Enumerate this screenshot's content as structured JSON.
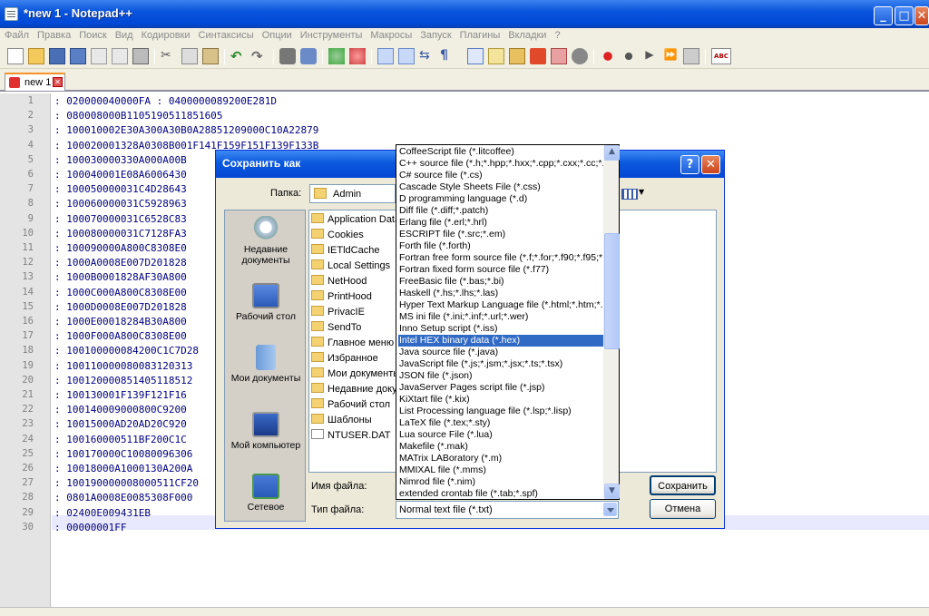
{
  "window": {
    "title": "*new 1 - Notepad++"
  },
  "menu": [
    "Файл",
    "Правка",
    "Поиск",
    "Вид",
    "Кодировки",
    "Синтаксисы",
    "Опции",
    "Инструменты",
    "Макросы",
    "Запуск",
    "Плагины",
    "Вкладки",
    "?"
  ],
  "tab": {
    "label": "new 1"
  },
  "editor": {
    "lines": [
      {
        "n": "1",
        "text": ": 020000040000FA : 0400000089200E281D"
      },
      {
        "n": "2",
        "text": ": 080008000B1105190511851605"
      },
      {
        "n": "3",
        "text": ": 100010002E30A300A30B0A28851209000C10A22879"
      },
      {
        "n": "4",
        "text": ": 100020001328A0308B001F141F159F151F139F133B"
      },
      {
        "n": "5",
        "text": ": 100030000330A000A00B"
      },
      {
        "n": "6",
        "text": ": 100040001E08A6006430"
      },
      {
        "n": "7",
        "text": ": 100050000031C4D28643"
      },
      {
        "n": "8",
        "text": ": 100060000031C5928963"
      },
      {
        "n": "9",
        "text": ": 100070000031C6528C83"
      },
      {
        "n": "10",
        "text": ": 100080000031C7128FA3"
      },
      {
        "n": "11",
        "text": ": 100090000A800C8308E0"
      },
      {
        "n": "12",
        "text": ": 1000A0008E007D201828"
      },
      {
        "n": "13",
        "text": ": 1000B0001828AF30A800"
      },
      {
        "n": "14",
        "text": ": 1000C000A800C8308E00"
      },
      {
        "n": "15",
        "text": ": 1000D0008E007D201828"
      },
      {
        "n": "16",
        "text": ": 1000E00018284B30A800"
      },
      {
        "n": "17",
        "text": ": 1000F000A800C8308E00"
      },
      {
        "n": "18",
        "text": ": 100100000084200C1C7D28"
      },
      {
        "n": "19",
        "text": ": 100110000080083120313"
      },
      {
        "n": "20",
        "text": ": 100120000851405118512"
      },
      {
        "n": "21",
        "text": ": 100130001F139F121F16"
      },
      {
        "n": "22",
        "text": ": 100140009000800C9200"
      },
      {
        "n": "23",
        "text": ": 10015000AD20AD20C920"
      },
      {
        "n": "24",
        "text": ": 100160000511BF200C1C"
      },
      {
        "n": "25",
        "text": ": 100170000C10080096306"
      },
      {
        "n": "26",
        "text": ": 10018000A1000130A200A"
      },
      {
        "n": "27",
        "text": ": 100190000008000511CF20"
      },
      {
        "n": "28",
        "text": ": 0801A0008E0085308F000"
      },
      {
        "n": "29",
        "text": ": 02400E009431EB"
      },
      {
        "n": "30",
        "text": ": 00000001FF"
      }
    ]
  },
  "dialog": {
    "title": "Сохранить как",
    "folder_label": "Папка:",
    "folder_value": "Admin",
    "places": [
      "Недавние документы",
      "Рабочий стол",
      "Мои документы",
      "Мой компьютер",
      "Сетевое"
    ],
    "files": [
      "Application Data",
      "Cookies",
      "IETldCache",
      "Local Settings",
      "NetHood",
      "PrintHood",
      "PrivacIE",
      "SendTo",
      "Главное меню",
      "Избранное",
      "Мои документы",
      "Недавние доку",
      "Рабочий стол",
      "Шаблоны",
      "NTUSER.DAT"
    ],
    "filename_label": "Имя файла:",
    "filetype_label": "Тип файла:",
    "filetype_value": "Normal text file (*.txt)",
    "save_button": "Сохранить",
    "cancel_button": "Отмена",
    "help_glyph": "?",
    "close_glyph": "✕"
  },
  "filetype_dropdown": {
    "selected": "Intel HEX binary data (*.hex)",
    "options": [
      "CoffeeScript file (*.litcoffee)",
      "C++ source file (*.h;*.hpp;*.hxx;*.cpp;*.cxx;*.cc;*.",
      "C# source file (*.cs)",
      "Cascade Style Sheets File (*.css)",
      "D programming language (*.d)",
      "Diff file (*.diff;*.patch)",
      "Erlang file (*.erl;*.hrl)",
      "ESCRIPT file (*.src;*.em)",
      "Forth file (*.forth)",
      "Fortran free form source file (*.f;*.for;*.f90;*.f95;*.",
      "Fortran fixed form source file (*.f77)",
      "FreeBasic file (*.bas;*.bi)",
      "Haskell (*.hs;*.lhs;*.las)",
      "Hyper Text Markup Language file (*.html;*.htm;*.",
      "MS ini file (*.ini;*.inf;*.url;*.wer)",
      "Inno Setup script (*.iss)",
      "Intel HEX binary data (*.hex)",
      "Java source file (*.java)",
      "JavaScript file (*.js;*.jsm;*.jsx;*.ts;*.tsx)",
      "JSON file (*.json)",
      "JavaServer Pages script file (*.jsp)",
      "KiXtart file (*.kix)",
      "List Processing language file (*.lsp;*.lisp)",
      "LaTeX file (*.tex;*.sty)",
      "Lua source File (*.lua)",
      "Makefile (*.mak)",
      "MATrix LABoratory (*.m)",
      "MMIXAL file (*.mms)",
      "Nimrod file (*.nim)",
      "extended crontab file (*.tab;*.spf)"
    ]
  }
}
